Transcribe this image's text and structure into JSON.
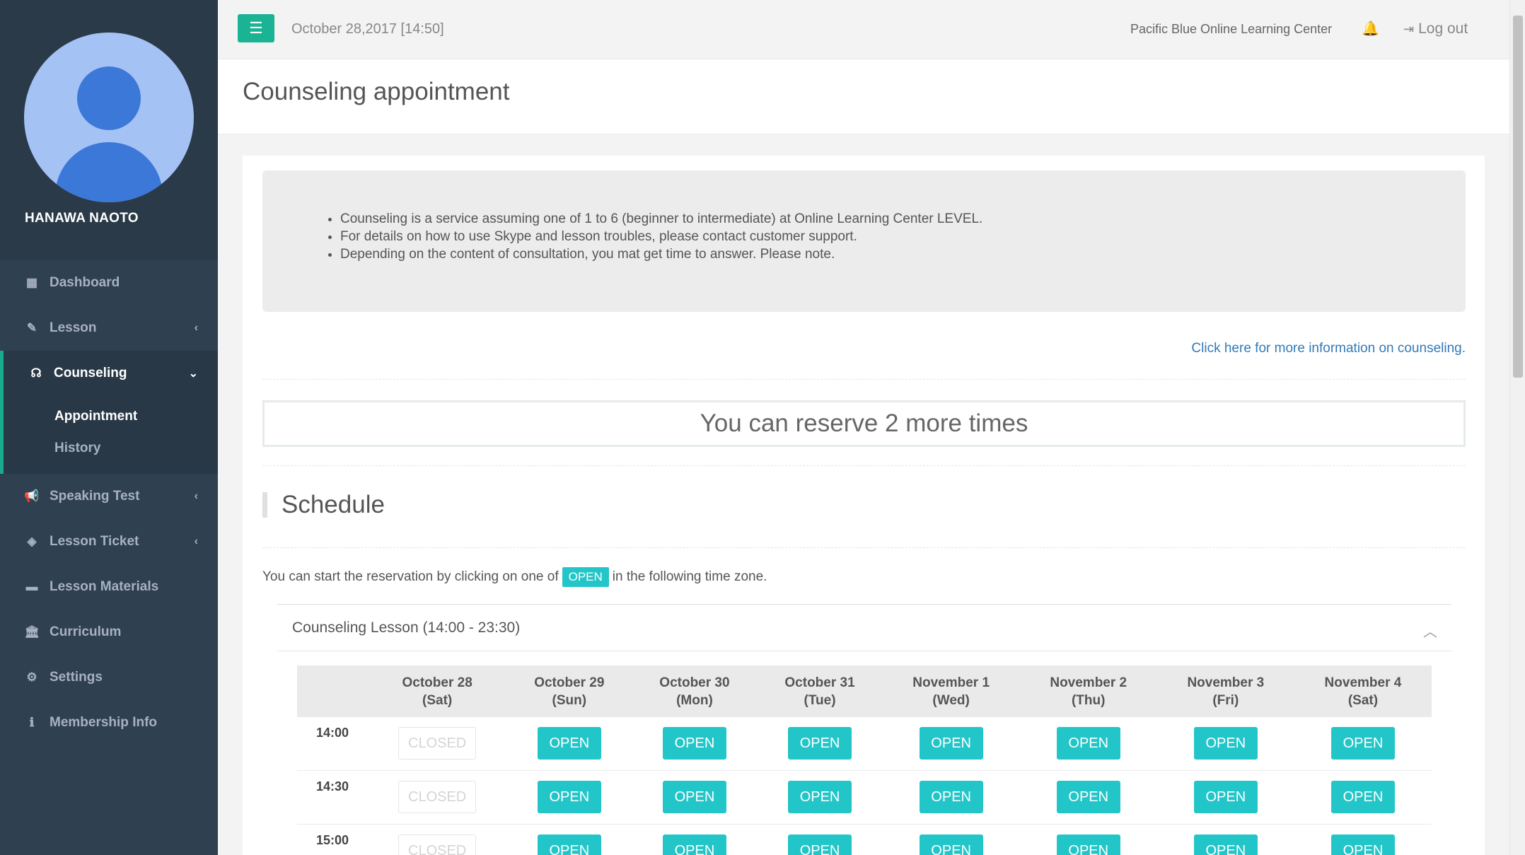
{
  "user": {
    "name": "HANAWA NAOTO"
  },
  "sidebar": {
    "items": [
      {
        "label": "Dashboard",
        "icon": "dashboard-icon"
      },
      {
        "label": "Lesson",
        "icon": "edit-icon"
      },
      {
        "label": "Counseling",
        "icon": "headphones-icon"
      },
      {
        "label": "Speaking Test",
        "icon": "megaphone-icon"
      },
      {
        "label": "Lesson Ticket",
        "icon": "ticket-icon"
      },
      {
        "label": "Lesson Materials",
        "icon": "folder-icon"
      },
      {
        "label": "Curriculum",
        "icon": "institution-icon"
      },
      {
        "label": "Settings",
        "icon": "cogs-icon"
      },
      {
        "label": "Membership Info",
        "icon": "info-icon"
      }
    ],
    "sub_items": [
      {
        "label": "Appointment"
      },
      {
        "label": "History"
      }
    ]
  },
  "topbar": {
    "datetime": "October 28,2017 [14:50]",
    "center_name": "Pacific Blue Online Learning Center",
    "logout_label": "Log out"
  },
  "page": {
    "title": "Counseling appointment"
  },
  "info": {
    "bullets": [
      "Counseling is a service assuming one of 1 to 6 (beginner to intermediate) at Online Learning Center LEVEL.",
      "For details on how to use Skype and lesson troubles, please contact customer support.",
      "Depending on the content of consultation, you mat get time to answer. Please note."
    ],
    "more_link": "Click here for more information on counseling."
  },
  "reserve": {
    "text": "You can reserve 2 more times"
  },
  "schedule": {
    "title": "Schedule",
    "intro_before": "You can start the reservation by clicking on one of",
    "intro_badge": "OPEN",
    "intro_after": "in the following time zone.",
    "accordion_title": "Counseling Lesson (14:00 - 23:30)",
    "columns": [
      {
        "date": "October 28",
        "day": "(Sat)"
      },
      {
        "date": "October 29",
        "day": "(Sun)"
      },
      {
        "date": "October 30",
        "day": "(Mon)"
      },
      {
        "date": "October 31",
        "day": "(Tue)"
      },
      {
        "date": "November 1",
        "day": "(Wed)"
      },
      {
        "date": "November 2",
        "day": "(Thu)"
      },
      {
        "date": "November 3",
        "day": "(Fri)"
      },
      {
        "date": "November 4",
        "day": "(Sat)"
      }
    ],
    "rows": [
      {
        "time": "14:00",
        "slots": [
          "CLOSED",
          "OPEN",
          "OPEN",
          "OPEN",
          "OPEN",
          "OPEN",
          "OPEN",
          "OPEN"
        ]
      },
      {
        "time": "14:30",
        "slots": [
          "CLOSED",
          "OPEN",
          "OPEN",
          "OPEN",
          "OPEN",
          "OPEN",
          "OPEN",
          "OPEN"
        ]
      },
      {
        "time": "15:00",
        "slots": [
          "CLOSED",
          "OPEN",
          "OPEN",
          "OPEN",
          "OPEN",
          "OPEN",
          "OPEN",
          "OPEN"
        ]
      }
    ]
  },
  "colors": {
    "sidebar_bg": "#2f4050",
    "accent_green": "#1ab394",
    "open_teal": "#23c6c8",
    "link_blue": "#337ab7"
  }
}
